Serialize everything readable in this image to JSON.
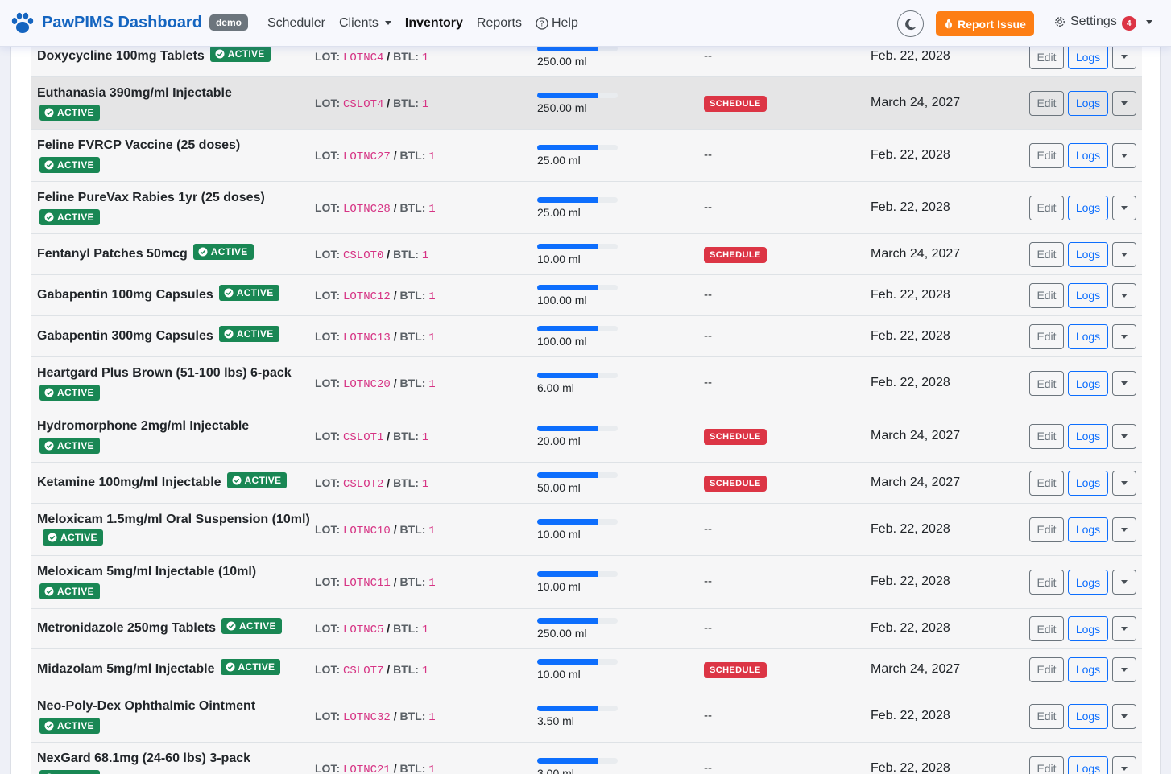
{
  "nav": {
    "brand": "PawPIMS Dashboard",
    "badge": "demo",
    "links": {
      "scheduler": "Scheduler",
      "clients": "Clients",
      "inventory": "Inventory",
      "reports": "Reports",
      "help": "Help"
    },
    "report_issue": "Report Issue",
    "settings": "Settings",
    "settings_count": "4"
  },
  "labels": {
    "lot": "LOT:",
    "btl": "BTL:",
    "edit": "Edit",
    "logs": "Logs",
    "active": "ACTIVE",
    "schedule": "SCHEDULE",
    "none": "--"
  },
  "colors": {
    "brand": "#1565c0",
    "active": "#198754",
    "schedule": "#dc3545",
    "report": "#fd7e14",
    "progress": "#0d6efd"
  },
  "items": [
    {
      "name": "Doxycycline 100mg Tablets",
      "lot": "LOTNC4",
      "btl": "1",
      "qty": "250.00 ml",
      "fill": 0.75,
      "schedule": false,
      "exp": "Feb. 22, 2028"
    },
    {
      "name": "Euthanasia 390mg/ml Injectable",
      "lot": "CSLOT4",
      "btl": "1",
      "qty": "250.00 ml",
      "fill": 0.75,
      "schedule": true,
      "exp": "March 24, 2027"
    },
    {
      "name": "Feline FVRCP Vaccine (25 doses)",
      "lot": "LOTNC27",
      "btl": "1",
      "qty": "25.00 ml",
      "fill": 0.75,
      "schedule": false,
      "exp": "Feb. 22, 2028"
    },
    {
      "name": "Feline PureVax Rabies 1yr (25 doses)",
      "lot": "LOTNC28",
      "btl": "1",
      "qty": "25.00 ml",
      "fill": 0.75,
      "schedule": false,
      "exp": "Feb. 22, 2028"
    },
    {
      "name": "Fentanyl Patches 50mcg",
      "lot": "CSLOT0",
      "btl": "1",
      "qty": "10.00 ml",
      "fill": 0.75,
      "schedule": true,
      "exp": "March 24, 2027"
    },
    {
      "name": "Gabapentin 100mg Capsules",
      "lot": "LOTNC12",
      "btl": "1",
      "qty": "100.00 ml",
      "fill": 0.75,
      "schedule": false,
      "exp": "Feb. 22, 2028"
    },
    {
      "name": "Gabapentin 300mg Capsules",
      "lot": "LOTNC13",
      "btl": "1",
      "qty": "100.00 ml",
      "fill": 0.75,
      "schedule": false,
      "exp": "Feb. 22, 2028"
    },
    {
      "name": "Heartgard Plus Brown (51-100 lbs) 6-pack",
      "lot": "LOTNC20",
      "btl": "1",
      "qty": "6.00 ml",
      "fill": 0.75,
      "schedule": false,
      "exp": "Feb. 22, 2028"
    },
    {
      "name": "Hydromorphone 2mg/ml Injectable",
      "lot": "CSLOT1",
      "btl": "1",
      "qty": "20.00 ml",
      "fill": 0.75,
      "schedule": true,
      "exp": "March 24, 2027"
    },
    {
      "name": "Ketamine 100mg/ml Injectable",
      "lot": "CSLOT2",
      "btl": "1",
      "qty": "50.00 ml",
      "fill": 0.75,
      "schedule": true,
      "exp": "March 24, 2027"
    },
    {
      "name": "Meloxicam 1.5mg/ml Oral Suspension (10ml)",
      "lot": "LOTNC10",
      "btl": "1",
      "qty": "10.00 ml",
      "fill": 0.75,
      "schedule": false,
      "exp": "Feb. 22, 2028"
    },
    {
      "name": "Meloxicam 5mg/ml Injectable (10ml)",
      "lot": "LOTNC11",
      "btl": "1",
      "qty": "10.00 ml",
      "fill": 0.75,
      "schedule": false,
      "exp": "Feb. 22, 2028"
    },
    {
      "name": "Metronidazole 250mg Tablets",
      "lot": "LOTNC5",
      "btl": "1",
      "qty": "250.00 ml",
      "fill": 0.75,
      "schedule": false,
      "exp": "Feb. 22, 2028"
    },
    {
      "name": "Midazolam 5mg/ml Injectable",
      "lot": "CSLOT7",
      "btl": "1",
      "qty": "10.00 ml",
      "fill": 0.75,
      "schedule": true,
      "exp": "March 24, 2027"
    },
    {
      "name": "Neo-Poly-Dex Ophthalmic Ointment",
      "lot": "LOTNC32",
      "btl": "1",
      "qty": "3.50 ml",
      "fill": 0.75,
      "schedule": false,
      "exp": "Feb. 22, 2028"
    },
    {
      "name": "NexGard 68.1mg (24-60 lbs) 3-pack",
      "lot": "LOTNC21",
      "btl": "1",
      "qty": "3.00 ml",
      "fill": 0.75,
      "schedule": false,
      "exp": "Feb. 22, 2028"
    }
  ]
}
